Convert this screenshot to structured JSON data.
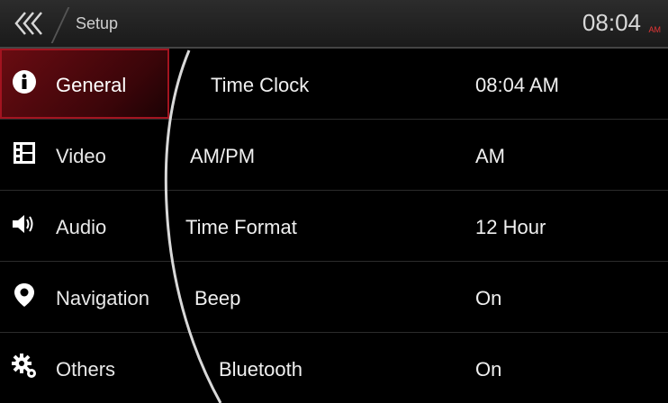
{
  "header": {
    "title": "Setup",
    "clock": "08:04",
    "clock_ampm": "AM"
  },
  "sidebar": {
    "items": [
      {
        "label": "General",
        "icon": "info-icon",
        "active": true
      },
      {
        "label": "Video",
        "icon": "film-icon"
      },
      {
        "label": "Audio",
        "icon": "speaker-icon"
      },
      {
        "label": "Navigation",
        "icon": "map-pin-icon"
      },
      {
        "label": "Others",
        "icon": "gear-icon"
      }
    ]
  },
  "settings": {
    "rows": [
      {
        "name": "Time Clock",
        "value": "08:04 AM"
      },
      {
        "name": "AM/PM",
        "value": "AM"
      },
      {
        "name": "Time Format",
        "value": "12 Hour"
      },
      {
        "name": "Beep",
        "value": "On"
      },
      {
        "name": "Bluetooth",
        "value": "On"
      }
    ]
  },
  "colors": {
    "accent": "#a31420",
    "ampm": "#e53535",
    "background": "#000000"
  }
}
